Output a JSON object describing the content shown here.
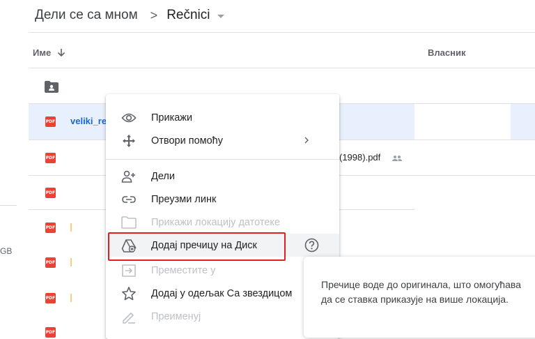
{
  "breadcrumb": {
    "root": "Дели се са мном",
    "separator": ">",
    "current": "Rečnici"
  },
  "columns": {
    "name": "Име",
    "owner": "Власник"
  },
  "storage": {
    "unit_fragment": "GB"
  },
  "files": [
    {
      "name_fragment": "veliki_re",
      "selected": true,
      "icon": "pdf-icon"
    },
    {
      "name_fragment": "(1998).pdf",
      "shared": true,
      "icon": "pdf-icon"
    },
    {
      "icon": "pdf-icon"
    },
    {
      "icon": "pdf-icon"
    },
    {
      "icon": "pdf-icon"
    },
    {
      "icon": "pdf-icon"
    },
    {
      "icon": "pdf-icon"
    }
  ],
  "pdf_badge": "PDF",
  "context_menu": {
    "items": [
      {
        "label": "Прикажи",
        "icon": "eye-icon"
      },
      {
        "label": "Отвори помоћу",
        "icon": "move-arrows-icon",
        "submenu": true
      },
      {
        "label": "Дели",
        "icon": "add-person-icon"
      },
      {
        "label": "Преузми линк",
        "icon": "link-icon"
      },
      {
        "label": "Прикажи локацију датотеке",
        "icon": "folder-outline-icon",
        "disabled": true
      },
      {
        "label": "Додај пречицу на Диск",
        "icon": "drive-shortcut-icon",
        "highlighted": true
      },
      {
        "label": "Преместите у",
        "icon": "move-to-icon",
        "disabled": true
      },
      {
        "label": "Додај у одељак Са звездицом",
        "icon": "star-icon"
      },
      {
        "label": "Преименуј",
        "icon": "pencil-icon",
        "disabled": true
      }
    ]
  },
  "tooltip": {
    "text": "Пречице воде до оригинала, што омогућава да се ставка приказује на више локација."
  },
  "colors": {
    "accent": "#1967d2",
    "selected_row": "#e8f0fe",
    "pdf_red": "#ea4335",
    "highlight_red": "#e02020"
  }
}
